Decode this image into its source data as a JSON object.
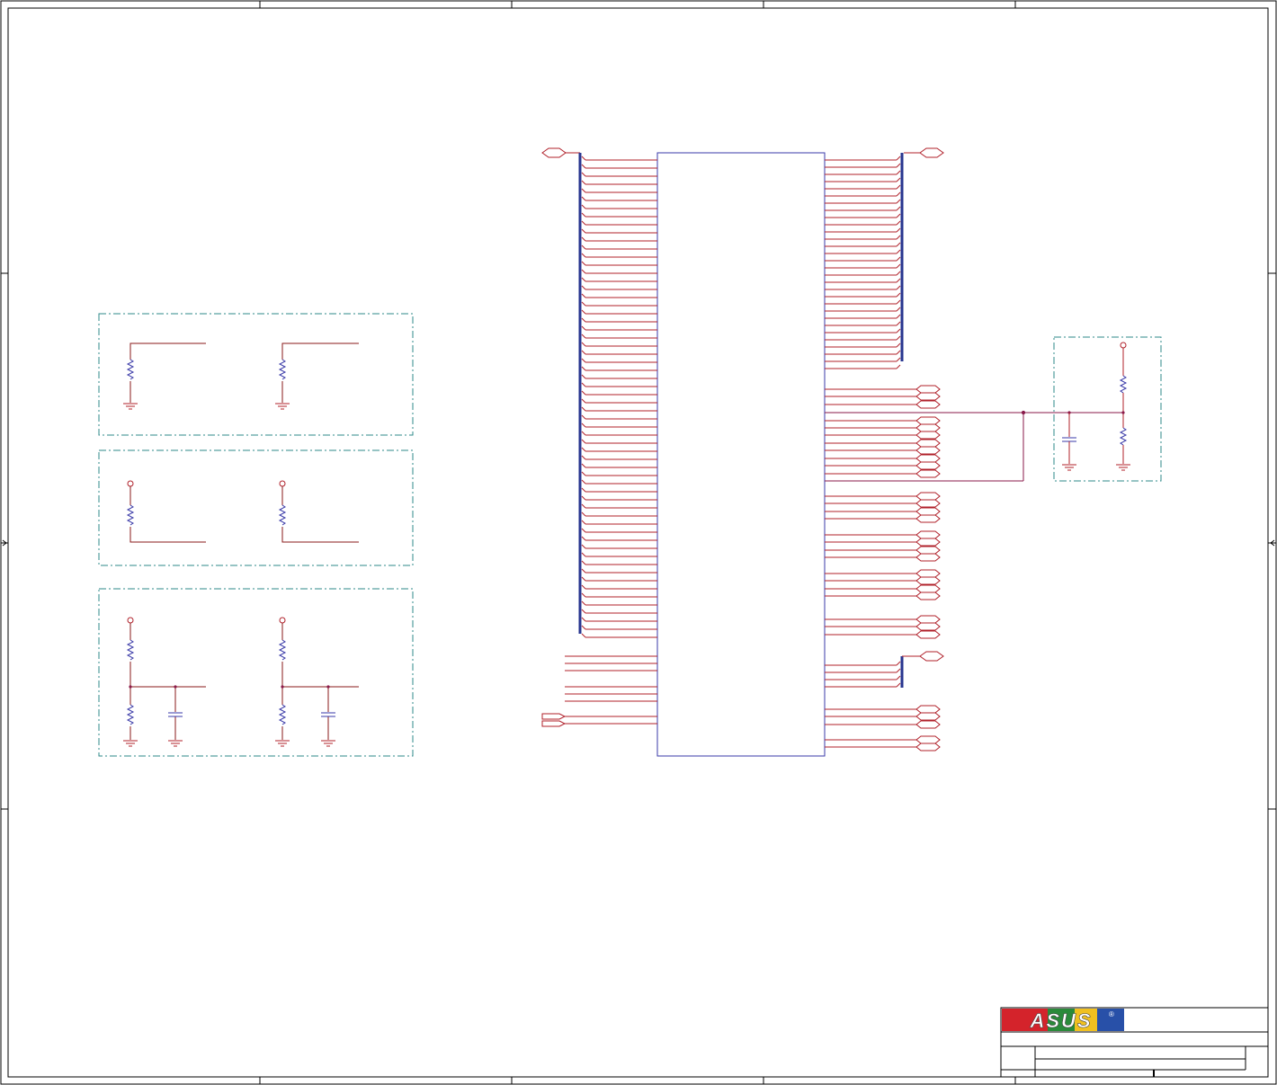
{
  "title_block": {
    "logo_text": "ASUS",
    "logo_registered_mark": "®"
  },
  "colors": {
    "net_wire": "#b0202a",
    "bus_wire": "#27358f",
    "component_blue": "#3a3aa8",
    "group_box_dash": "#2d8a8a",
    "frame": "#000000",
    "logo_background": "#d4232b"
  },
  "components": {
    "main_ic": "connector-ic-symbol",
    "left_bus_pins": 60,
    "right_bus_pins": 30
  }
}
